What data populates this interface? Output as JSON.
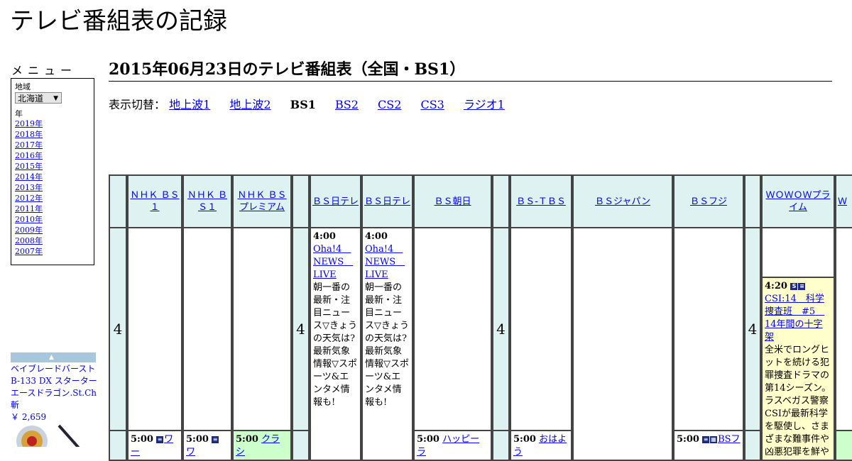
{
  "site_title": "テレビ番組表の記録",
  "menu": {
    "heading": "メニュー",
    "region_label": "地域",
    "region_value": "北海道",
    "year_label": "年",
    "years": [
      "2019年",
      "2018年",
      "2017年",
      "2016年",
      "2015年",
      "2014年",
      "2013年",
      "2012年",
      "2011年",
      "2010年",
      "2009年",
      "2008年",
      "2007年"
    ]
  },
  "product": {
    "name": "ベイブレードバーストB-133 DX スターター エースドラゴン.St.Ch 斬",
    "price": "￥ 2,659"
  },
  "page_heading": "2015年06月23日のテレビ番組表（全国・BS1）",
  "switcher": {
    "label": "表示切替：",
    "items": [
      "地上波1",
      "地上波2",
      "BS1",
      "BS2",
      "CS2",
      "CS3",
      "ラジオ1"
    ],
    "current": "BS1"
  },
  "channels": [
    "ＮＨＫ ＢＳ１",
    "ＮＨＫ ＢＳ１",
    "ＮＨＫ ＢＳプレミアム",
    "ＢＳ日テレ",
    "ＢＳ日テレ",
    "ＢＳ朝日",
    "ＢＳ-ＴＢＳ",
    "ＢＳジャパン",
    "ＢＳフジ",
    "ＷＯＷＯＷプライム",
    "Ｗ"
  ],
  "hour": "4",
  "programs": {
    "bsnt1": {
      "time": "4:00",
      "title": "Oha!4　NEWS　LIVE",
      "desc": "朝一番の最新・注目ニュース▽きょうの天気は?最新気象情報▽スポーツ&エンタメ情報も!"
    },
    "bsnt2": {
      "time": "4:00",
      "title": "Oha!4　NEWS　LIVE",
      "desc": "朝一番の最新・注目ニュース▽きょうの天気は?最新気象情報▽スポーツ&エンタメ情報も!"
    },
    "wowow": {
      "time": "4:20",
      "title": "CSI:14　科学捜査班　#5　14年間の十字架",
      "desc": "全米でロングヒットを続ける犯罪捜査ドラマの第14シーズン。ラスベガス警察CSIが最新科学を駆使し、さまざまな難事件や凶悪犯罪を鮮やかに"
    },
    "nhk1": {
      "time": "5:00",
      "title": "ワー"
    },
    "nhk2": {
      "time": "5:00",
      "title": "ワ"
    },
    "nhkp": {
      "time": "5:00",
      "title": "クラシ"
    },
    "asahi": {
      "time": "5:00",
      "title": "ハッピーラ"
    },
    "tbs": {
      "time": "5:00",
      "title": "おはよう"
    },
    "fuji": {
      "time": "5:00",
      "title": "BSフ"
    }
  }
}
